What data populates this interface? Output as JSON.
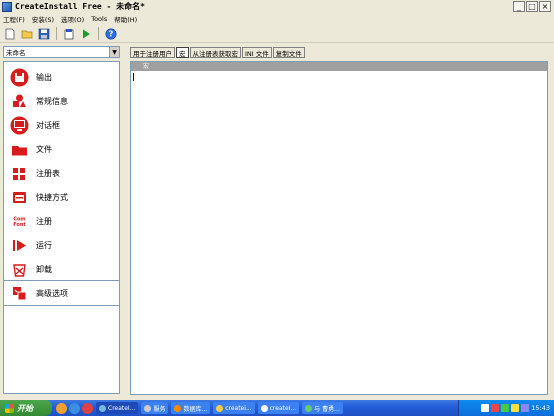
{
  "window": {
    "title": "CreateInstall Free - 未命名*",
    "min": "_",
    "max": "□",
    "close": "×"
  },
  "menu": [
    "工程(F)",
    "安装(S)",
    "选项(O)",
    "Tools",
    "帮助(H)"
  ],
  "project_combo": {
    "value": "未命名"
  },
  "nav_items": [
    {
      "id": "output",
      "label": "输出",
      "icon": "disk-icon",
      "color": "#d11b1b"
    },
    {
      "id": "general",
      "label": "常规信息",
      "icon": "shapes-icon",
      "color": "#d11b1b"
    },
    {
      "id": "dialogs",
      "label": "对话框",
      "icon": "monitor-icon",
      "color": "#d11b1b"
    },
    {
      "id": "files",
      "label": "文件",
      "icon": "folder-icon",
      "color": "#d11b1b"
    },
    {
      "id": "registry",
      "label": "注册表",
      "icon": "registry-icon",
      "color": "#d11b1b"
    },
    {
      "id": "shortcuts",
      "label": "快捷方式",
      "icon": "shortcut-icon",
      "color": "#d11b1b"
    },
    {
      "id": "register",
      "label": "注册",
      "icon": "com-icon",
      "color": "#d11b1b"
    },
    {
      "id": "run",
      "label": "运行",
      "icon": "play-icon",
      "color": "#d11b1b"
    },
    {
      "id": "uninstall",
      "label": "卸载",
      "icon": "trash-icon",
      "color": "#d11b1b"
    },
    {
      "id": "advanced",
      "label": "高级选项",
      "icon": "advanced-icon",
      "color": "#d11b1b"
    }
  ],
  "tabs": [
    "用于注册用户",
    "宏",
    "从注册表获取宏",
    "INI 文件",
    "复制文件"
  ],
  "editor": {
    "header": "宏"
  },
  "taskbar": {
    "start": "开始",
    "tasks": [
      "CreateI...",
      "服务",
      "数据库...",
      "createi...",
      "createI...",
      "与 曹勇..."
    ],
    "time": "15:43"
  }
}
